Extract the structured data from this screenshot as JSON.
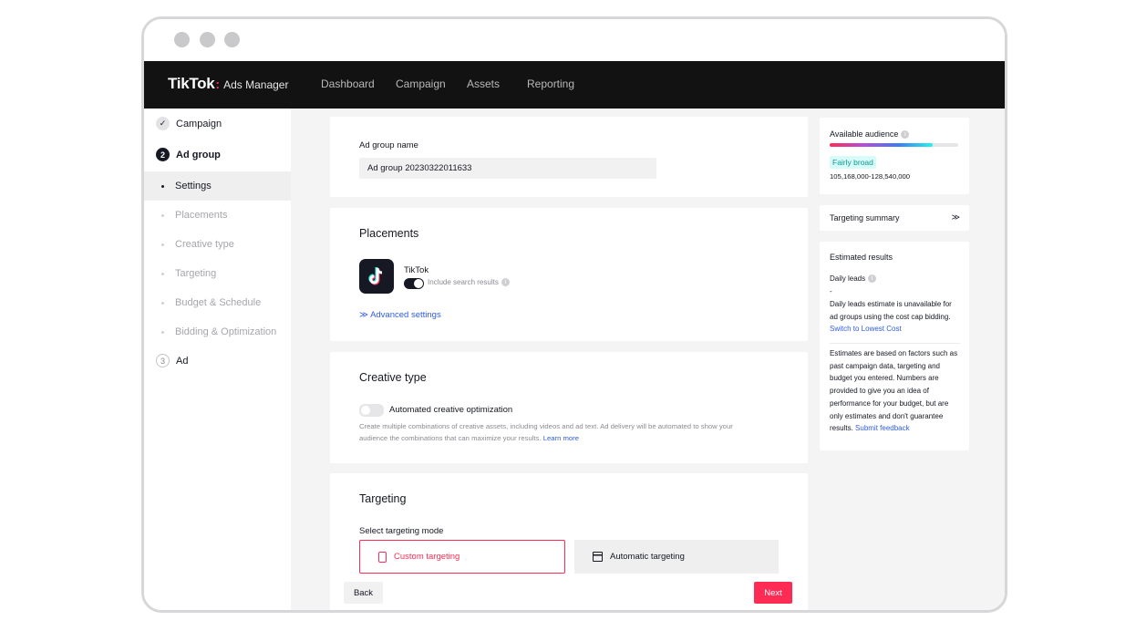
{
  "app": {
    "logo_main": "TikTok",
    "logo_sub": "Ads Manager",
    "nav": [
      "Dashboard",
      "Campaign",
      "Assets",
      "Reporting"
    ]
  },
  "sidebar": {
    "steps": [
      {
        "label": "Campaign",
        "marker": "✓"
      },
      {
        "label": "Ad group",
        "marker": "2"
      },
      {
        "label": "Ad",
        "marker": "3"
      }
    ],
    "subitems": [
      "Settings",
      "Placements",
      "Creative type",
      "Targeting",
      "Budget & Schedule",
      "Bidding & Optimization"
    ]
  },
  "ad_group_name": {
    "label": "Ad group name",
    "value": "Ad group 20230322011633"
  },
  "placements": {
    "title": "Placements",
    "app_name": "TikTok",
    "search_results_label": "Include search results",
    "search_results_on": true,
    "advanced_settings": "Advanced settings"
  },
  "creative_type": {
    "title": "Creative type",
    "toggle_label": "Automated creative optimization",
    "toggle_on": false,
    "description_line1": "Create multiple combinations of creative assets, including videos and ad text. Ad delivery will be automated to show your",
    "description_line2": "audience the combinations that can maximize your results.",
    "learn_more": "Learn more"
  },
  "targeting": {
    "title": "Targeting",
    "mode_label": "Select targeting mode",
    "custom": "Custom targeting",
    "automatic": "Automatic targeting"
  },
  "footer": {
    "back": "Back",
    "next": "Next"
  },
  "audience": {
    "title": "Available audience",
    "level_fraction": 0.8,
    "badge": "Fairly broad",
    "range": "105,168,000-128,540,000"
  },
  "targeting_summary": {
    "title": "Targeting summary"
  },
  "estimated": {
    "title": "Estimated results",
    "daily_leads_label": "Daily leads",
    "daily_leads_value": "-",
    "unavailable_line1": "Daily leads estimate is unavailable for",
    "unavailable_line2": "ad groups using the cost cap bidding.",
    "switch_link": "Switch to Lowest Cost",
    "note_lines": [
      "Estimates are based on factors such as",
      "past campaign data, targeting and",
      "budget you entered. Numbers are",
      "provided to give you an idea of",
      "performance for your budget, but are",
      "only estimates and don't guarantee"
    ],
    "note_last": "results.",
    "feedback_link": "Submit feedback"
  }
}
